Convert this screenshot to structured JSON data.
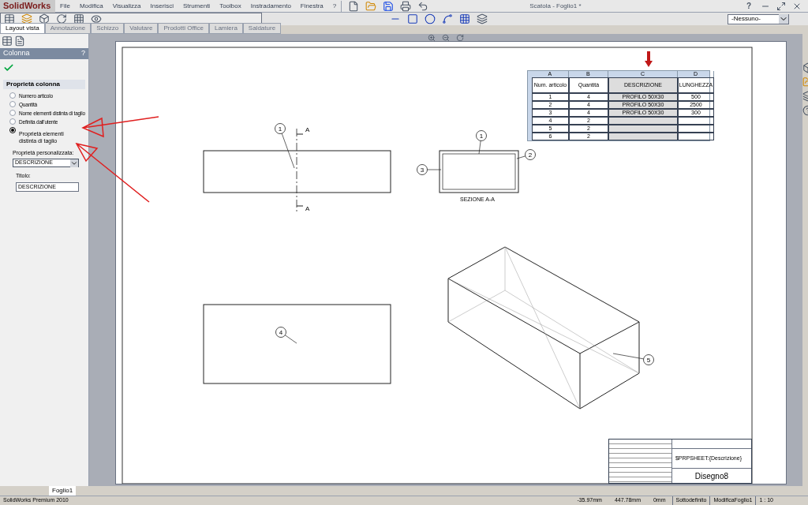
{
  "app": {
    "logo": "SolidWorks",
    "menu": [
      "File",
      "Modifica",
      "Visualizza",
      "Inserisci",
      "Strumenti",
      "Toolbox",
      "Instradamento",
      "Finestra",
      "?"
    ],
    "title": "Scatola - Foglio1 *",
    "help": "?",
    "style_select": "-Nessuno-"
  },
  "tabs": [
    {
      "label": "Layout vista",
      "selected": true
    },
    {
      "label": "Annotazione",
      "selected": false
    },
    {
      "label": "Schizzo",
      "selected": false
    },
    {
      "label": "Valutare",
      "selected": false
    },
    {
      "label": "Prodotti Office",
      "selected": false
    },
    {
      "label": "Lamiera",
      "selected": false
    },
    {
      "label": "Saldature",
      "selected": false
    }
  ],
  "panel": {
    "title": "Colonna",
    "help": "?",
    "section": "Proprietà colonna",
    "options": [
      {
        "label": "Numero articolo",
        "selected": false
      },
      {
        "label": "Quantità",
        "selected": false
      },
      {
        "label": "Nome elementi distinta di taglio",
        "selected": false
      },
      {
        "label": "Definita dall'utente",
        "selected": false
      },
      {
        "label": "Proprietà elementi distinta di taglio",
        "selected": true
      }
    ],
    "custom_label": "Proprietà personalizzata:",
    "custom_value": "DESCRIZIONE",
    "title_label": "Titolo:",
    "title_value": "DESCRIZIONE"
  },
  "table": {
    "column_letters": [
      "A",
      "B",
      "C",
      "D"
    ],
    "columns": [
      "Num. articolo",
      "Quantità",
      "DESCRIZIONE",
      "LUNGHEZZA"
    ],
    "rows": [
      [
        "1",
        "4",
        "PROFILO 50X30",
        "500"
      ],
      [
        "2",
        "4",
        "PROFILO 50X30",
        "2500"
      ],
      [
        "3",
        "4",
        "PROFILO 50X30",
        "300"
      ],
      [
        "4",
        "2",
        "",
        ""
      ],
      [
        "5",
        "2",
        "",
        ""
      ],
      [
        "6",
        "2",
        "",
        ""
      ]
    ]
  },
  "views": {
    "section_label": "SEZIONE A-A",
    "cut_letters": [
      "A",
      "A"
    ],
    "balloons": [
      "1",
      "1",
      "2",
      "3",
      "4",
      "5"
    ]
  },
  "title_block": {
    "sheet_title": "$PRPSHEET:{Descrizione}",
    "drawing_name": "Disegno8"
  },
  "sheet_tabs": [
    {
      "label": "Foglio1",
      "selected": true
    }
  ],
  "status": {
    "product": "SolidWorks Premium 2010",
    "x": "-35.97mm",
    "y": "447.78mm",
    "z": "0mm",
    "state": "Sottodefinito",
    "mode": "ModificaFoglio1",
    "scale": "1 : 10"
  }
}
